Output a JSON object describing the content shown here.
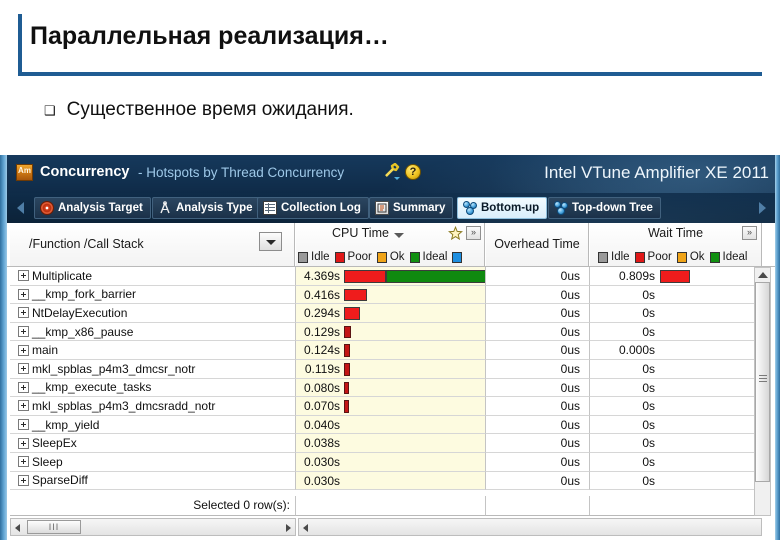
{
  "slide": {
    "title": "Параллельная реализация…",
    "bullet_glyph": "❑",
    "bullet_text": "Существенное время ожидания."
  },
  "vtune": {
    "app_icon_label": "Am",
    "mode": "Concurrency",
    "subtitle": "- Hotspots by Thread Concurrency",
    "brand": "Intel VTune Amplifier XE 2011",
    "help_glyph": "?",
    "toolbar": [
      {
        "label": "Analysis Target",
        "icon": "target-icon",
        "active": false
      },
      {
        "label": "Analysis Type",
        "icon": "compass-icon",
        "active": false
      },
      {
        "label": "Collection Log",
        "icon": "grid-icon",
        "active": false
      },
      {
        "label": "Summary",
        "icon": "summary-icon",
        "active": false
      },
      {
        "label": "Bottom-up",
        "icon": "molecule-icon",
        "active": true
      },
      {
        "label": "Top-down Tree",
        "icon": "molecule-icon",
        "active": false
      }
    ],
    "columns": {
      "function": "/Function /Call Stack",
      "cpu_time": "CPU Time",
      "overhead_time": "Overhead Time",
      "wait_time": "Wait Time"
    },
    "expand_glyph": "»",
    "legend_cpu": [
      {
        "name": "Idle",
        "color": "#9a9a9a"
      },
      {
        "name": "Poor",
        "color": "#e01818"
      },
      {
        "name": "Ok",
        "color": "#f0a418"
      },
      {
        "name": "Ideal",
        "color": "#119011"
      },
      {
        "name": "",
        "color": "#1f8fe0"
      }
    ],
    "legend_wait": [
      {
        "name": "Idle",
        "color": "#9a9a9a"
      },
      {
        "name": "Poor",
        "color": "#e01818"
      },
      {
        "name": "Ok",
        "color": "#f0a418"
      },
      {
        "name": "Ideal",
        "color": "#119011"
      }
    ],
    "status": "Selected 0 row(s):",
    "rows": [
      {
        "function": "Multiplicate",
        "cpu_time": "4.369s",
        "cpu_red": 42,
        "cpu_green": 120,
        "overhead_time": "0us",
        "wait_time": "0.809s",
        "wait_red": 30
      },
      {
        "function": "__kmp_fork_barrier",
        "cpu_time": "0.416s",
        "cpu_red": 23,
        "cpu_green": 0,
        "overhead_time": "0us",
        "wait_time": "0s",
        "wait_red": 0
      },
      {
        "function": "NtDelayExecution",
        "cpu_time": "0.294s",
        "cpu_red": 16,
        "cpu_green": 0,
        "overhead_time": "0us",
        "wait_time": "0s",
        "wait_red": 0
      },
      {
        "function": "__kmp_x86_pause",
        "cpu_time": "0.129s",
        "cpu_red": 7,
        "cpu_green": 0,
        "overhead_time": "0us",
        "wait_time": "0s",
        "wait_red": 0
      },
      {
        "function": "main",
        "cpu_time": "0.124s",
        "cpu_red": 6,
        "cpu_green": 0,
        "overhead_time": "0us",
        "wait_time": "0.000s",
        "wait_red": 0
      },
      {
        "function": "mkl_spblas_p4m3_dmcsr_notr",
        "cpu_time": "0.119s",
        "cpu_red": 6,
        "cpu_green": 0,
        "overhead_time": "0us",
        "wait_time": "0s",
        "wait_red": 0
      },
      {
        "function": "__kmp_execute_tasks",
        "cpu_time": "0.080s",
        "cpu_red": 5,
        "cpu_green": 0,
        "overhead_time": "0us",
        "wait_time": "0s",
        "wait_red": 0
      },
      {
        "function": "mkl_spblas_p4m3_dmcsradd_notr",
        "cpu_time": "0.070s",
        "cpu_red": 5,
        "cpu_green": 0,
        "overhead_time": "0us",
        "wait_time": "0s",
        "wait_red": 0
      },
      {
        "function": "__kmp_yield",
        "cpu_time": "0.040s",
        "cpu_red": 0,
        "cpu_green": 0,
        "overhead_time": "0us",
        "wait_time": "0s",
        "wait_red": 0
      },
      {
        "function": "SleepEx",
        "cpu_time": "0.038s",
        "cpu_red": 0,
        "cpu_green": 0,
        "overhead_time": "0us",
        "wait_time": "0s",
        "wait_red": 0
      },
      {
        "function": "Sleep",
        "cpu_time": "0.030s",
        "cpu_red": 0,
        "cpu_green": 0,
        "overhead_time": "0us",
        "wait_time": "0s",
        "wait_red": 0
      },
      {
        "function": "SparseDiff",
        "cpu_time": "0.030s",
        "cpu_red": 0,
        "cpu_green": 0,
        "overhead_time": "0us",
        "wait_time": "0s",
        "wait_red": 0
      }
    ]
  }
}
